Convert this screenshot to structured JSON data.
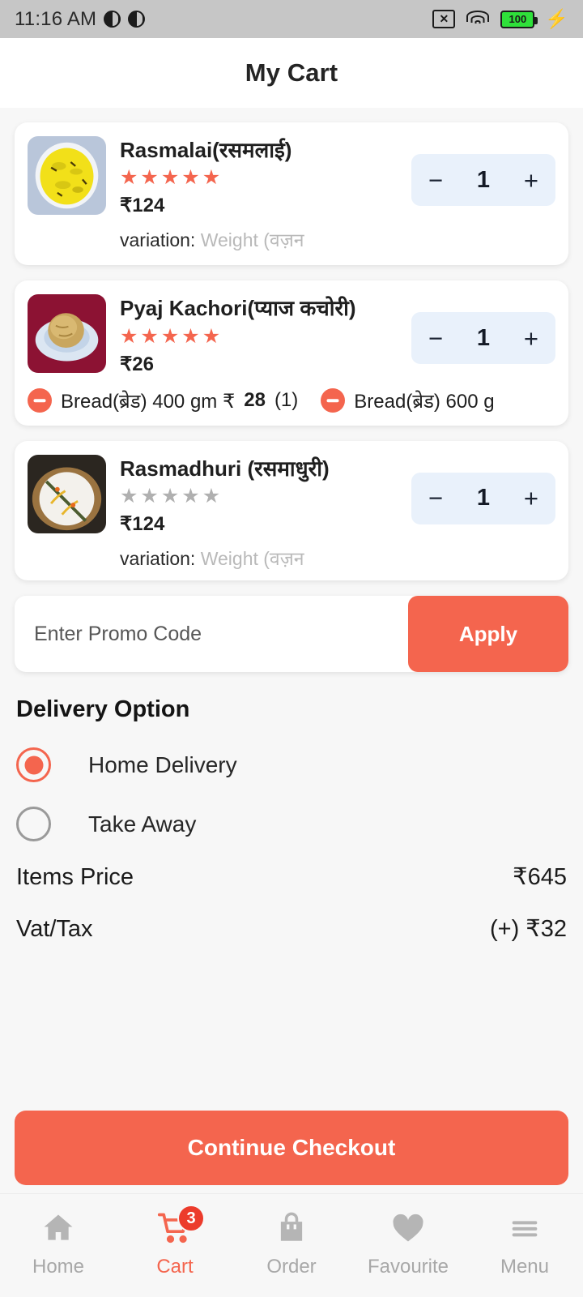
{
  "status_bar": {
    "time": "11:16 AM",
    "battery_level": "100",
    "icons": [
      "no-sim-icon",
      "wifi-icon",
      "battery-icon",
      "charging-bolt-icon"
    ]
  },
  "header": {
    "title": "My Cart"
  },
  "cart": {
    "items": [
      {
        "name": "Rasmalai(रसमलाई)",
        "rating": 5,
        "price": "₹124",
        "quantity": "1",
        "variation_label": "variation:",
        "variation_value": "Weight (वज़न",
        "minus_label": "−",
        "plus_label": "+",
        "addons": []
      },
      {
        "name": "Pyaj Kachori(प्याज कचोरी)",
        "rating": 5,
        "price": "₹26",
        "quantity": "1",
        "variation_label": "",
        "variation_value": "",
        "minus_label": "−",
        "plus_label": "+",
        "addons": [
          {
            "text_before": "Bread(ब्रेड) 400 gm ₹",
            "amount": "28",
            "text_after": " (1)"
          },
          {
            "text_before": "Bread(ब्रेड) 600 g",
            "amount": "",
            "text_after": ""
          }
        ]
      },
      {
        "name": "Rasmadhuri (रसमाधुरी)",
        "rating": 0,
        "price": "₹124",
        "quantity": "1",
        "variation_label": "variation:",
        "variation_value": "Weight (वज़न",
        "minus_label": "−",
        "plus_label": "+",
        "addons": []
      }
    ]
  },
  "promo": {
    "placeholder": "Enter Promo Code",
    "value": "",
    "apply_label": "Apply"
  },
  "delivery": {
    "title": "Delivery Option",
    "options": [
      {
        "label": "Home Delivery",
        "selected": true
      },
      {
        "label": "Take Away",
        "selected": false
      }
    ]
  },
  "totals": {
    "rows": [
      {
        "label": "Items Price",
        "value": "₹645"
      },
      {
        "label": "Vat/Tax",
        "value": "(+) ₹32"
      }
    ]
  },
  "checkout": {
    "label": "Continue Checkout"
  },
  "bottom_nav": {
    "items": [
      {
        "label": "Home",
        "icon": "home-icon",
        "active": false,
        "badge": ""
      },
      {
        "label": "Cart",
        "icon": "cart-icon",
        "active": true,
        "badge": "3"
      },
      {
        "label": "Order",
        "icon": "bag-icon",
        "active": false,
        "badge": ""
      },
      {
        "label": "Favourite",
        "icon": "heart-icon",
        "active": false,
        "badge": ""
      },
      {
        "label": "Menu",
        "icon": "hamburger-icon",
        "active": false,
        "badge": ""
      }
    ]
  },
  "colors": {
    "accent": "#f4654e",
    "badge": "#ec3b2b",
    "star_filled": "#f4654e",
    "star_empty": "#b0b0b0",
    "stepper_bg": "#e9f1fb",
    "page_bg": "#f7f7f7"
  }
}
